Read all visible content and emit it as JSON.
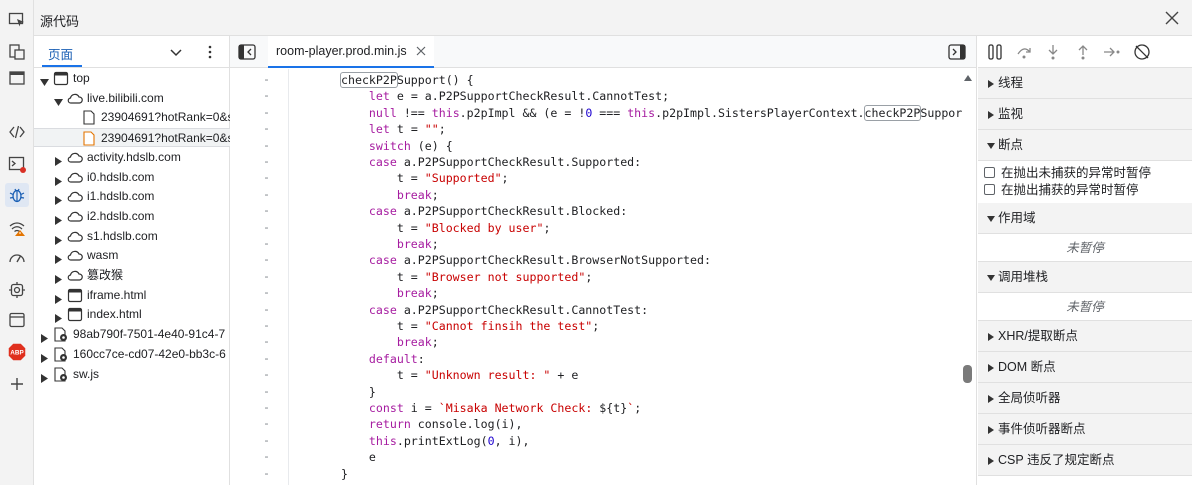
{
  "title_bar": {
    "title": "源代码",
    "close_icon": "close-icon"
  },
  "activity_bar": {
    "items": [
      {
        "name": "inspect-icon"
      },
      {
        "name": "device-icon"
      },
      {
        "name": "window-icon"
      },
      {
        "name": "elements-icon"
      },
      {
        "name": "console-icon"
      },
      {
        "name": "sources-bug-icon"
      },
      {
        "name": "network-warning-icon"
      },
      {
        "name": "performance-icon"
      },
      {
        "name": "settings-gear-icon"
      },
      {
        "name": "application-icon"
      },
      {
        "name": "abp-icon",
        "label": "ABP"
      },
      {
        "name": "add-icon"
      }
    ]
  },
  "navigator": {
    "tab": "页面",
    "tree": [
      {
        "label": "top",
        "type": "frame",
        "expanded": true,
        "level": 0
      },
      {
        "label": "live.bilibili.com",
        "type": "cloud",
        "expanded": true,
        "level": 1
      },
      {
        "label": "23904691?hotRank=0&s",
        "type": "file",
        "level": 2
      },
      {
        "label": "23904691?hotRank=0&s",
        "type": "file-orange",
        "level": 2,
        "selected": true
      },
      {
        "label": "activity.hdslb.com",
        "type": "cloud",
        "expanded": false,
        "level": 1
      },
      {
        "label": "i0.hdslb.com",
        "type": "cloud",
        "expanded": false,
        "level": 1
      },
      {
        "label": "i1.hdslb.com",
        "type": "cloud",
        "expanded": false,
        "level": 1
      },
      {
        "label": "i2.hdslb.com",
        "type": "cloud",
        "expanded": false,
        "level": 1
      },
      {
        "label": "s1.hdslb.com",
        "type": "cloud",
        "expanded": false,
        "level": 1
      },
      {
        "label": "wasm",
        "type": "cloud",
        "expanded": false,
        "level": 1
      },
      {
        "label": "篡改猴",
        "type": "cloud",
        "expanded": false,
        "level": 1
      },
      {
        "label": "iframe.html",
        "type": "frame",
        "expanded": false,
        "level": 1
      },
      {
        "label": "index.html",
        "type": "frame",
        "expanded": false,
        "level": 1
      },
      {
        "label": "98ab790f-7501-4e40-91c4-7",
        "type": "gear-file",
        "expanded": false,
        "level": 0
      },
      {
        "label": "160cc7ce-cd07-42e0-bb3c-6",
        "type": "gear-file",
        "expanded": false,
        "level": 0
      },
      {
        "label": "sw.js",
        "type": "gear-file",
        "expanded": false,
        "level": 0
      }
    ]
  },
  "editor": {
    "file_tab": "room-player.prod.min.js",
    "gutter_mark": "-",
    "lines": [
      [
        [
          "hl",
          "checkP2P"
        ],
        [
          "",
          "Support() {"
        ]
      ],
      [
        [
          "",
          "    "
        ],
        [
          "kw",
          "let"
        ],
        [
          "",
          " e = a.P2PSupportCheckResult.CannotTest;"
        ]
      ],
      [
        [
          "",
          "    "
        ],
        [
          "kw",
          "null"
        ],
        [
          "",
          " !== "
        ],
        [
          "kw",
          "this"
        ],
        [
          "",
          ".p2pImpl && (e = !"
        ],
        [
          "num",
          "0"
        ],
        [
          "",
          " === "
        ],
        [
          "kw",
          "this"
        ],
        [
          "",
          ".p2pImpl.SistersPlayerContext."
        ],
        [
          "hl",
          "checkP2P"
        ],
        [
          "",
          "Support() ? a"
        ]
      ],
      [
        [
          "",
          "    "
        ],
        [
          "kw",
          "let"
        ],
        [
          "",
          " t = "
        ],
        [
          "str",
          "\"\""
        ],
        [
          "",
          ";"
        ]
      ],
      [
        [
          "",
          "    "
        ],
        [
          "kw",
          "switch"
        ],
        [
          "",
          " (e) {"
        ]
      ],
      [
        [
          "",
          "    "
        ],
        [
          "kw",
          "case"
        ],
        [
          "",
          " a.P2PSupportCheckResult.Supported:"
        ]
      ],
      [
        [
          "",
          "        t = "
        ],
        [
          "str",
          "\"Supported\""
        ],
        [
          "",
          ";"
        ]
      ],
      [
        [
          "",
          "        "
        ],
        [
          "kw",
          "break"
        ],
        [
          "",
          ";"
        ]
      ],
      [
        [
          "",
          "    "
        ],
        [
          "kw",
          "case"
        ],
        [
          "",
          " a.P2PSupportCheckResult.Blocked:"
        ]
      ],
      [
        [
          "",
          "        t = "
        ],
        [
          "str",
          "\"Blocked by user\""
        ],
        [
          "",
          ";"
        ]
      ],
      [
        [
          "",
          "        "
        ],
        [
          "kw",
          "break"
        ],
        [
          "",
          ";"
        ]
      ],
      [
        [
          "",
          "    "
        ],
        [
          "kw",
          "case"
        ],
        [
          "",
          " a.P2PSupportCheckResult.BrowserNotSupported:"
        ]
      ],
      [
        [
          "",
          "        t = "
        ],
        [
          "str",
          "\"Browser not supported\""
        ],
        [
          "",
          ";"
        ]
      ],
      [
        [
          "",
          "        "
        ],
        [
          "kw",
          "break"
        ],
        [
          "",
          ";"
        ]
      ],
      [
        [
          "",
          "    "
        ],
        [
          "kw",
          "case"
        ],
        [
          "",
          " a.P2PSupportCheckResult.CannotTest:"
        ]
      ],
      [
        [
          "",
          "        t = "
        ],
        [
          "str",
          "\"Cannot finsih the test\""
        ],
        [
          "",
          ";"
        ]
      ],
      [
        [
          "",
          "        "
        ],
        [
          "kw",
          "break"
        ],
        [
          "",
          ";"
        ]
      ],
      [
        [
          "",
          "    "
        ],
        [
          "kw",
          "default"
        ],
        [
          "",
          ":"
        ]
      ],
      [
        [
          "",
          "        t = "
        ],
        [
          "str",
          "\"Unknown result: \""
        ],
        [
          "",
          " + e"
        ]
      ],
      [
        [
          "",
          "    }"
        ]
      ],
      [
        [
          "",
          "    "
        ],
        [
          "kw",
          "const"
        ],
        [
          "",
          " i = "
        ],
        [
          "str",
          "`Misaka Network Check: "
        ],
        [
          "",
          "${t}"
        ],
        [
          "str",
          "`"
        ],
        [
          "",
          ";"
        ]
      ],
      [
        [
          "",
          "    "
        ],
        [
          "kw",
          "return"
        ],
        [
          "",
          " console.log(i),"
        ]
      ],
      [
        [
          "",
          "    "
        ],
        [
          "kw",
          "this"
        ],
        [
          "",
          ".printExtLog("
        ],
        [
          "num",
          "0"
        ],
        [
          "",
          ", i),"
        ]
      ],
      [
        [
          "",
          "    e"
        ]
      ],
      [
        [
          "",
          "}"
        ]
      ]
    ]
  },
  "debugger": {
    "toolbar": [
      {
        "name": "pause-icon"
      },
      {
        "name": "step-over-icon"
      },
      {
        "name": "step-into-icon"
      },
      {
        "name": "step-out-icon"
      },
      {
        "name": "step-icon"
      },
      {
        "name": "deactivate-breakpoints-icon"
      }
    ],
    "threads": "线程",
    "watch": "监视",
    "breakpoints": "断点",
    "pause_uncaught": "在抛出未捕获的异常时暂停",
    "pause_caught": "在抛出捕获的异常时暂停",
    "scope": "作用域",
    "scope_empty": "未暂停",
    "call_stack": "调用堆栈",
    "call_stack_empty": "未暂停",
    "xhr": "XHR/提取断点",
    "dom": "DOM 断点",
    "global": "全局侦听器",
    "event": "事件侦听器断点",
    "csp": "CSP 违反了规定断点"
  }
}
